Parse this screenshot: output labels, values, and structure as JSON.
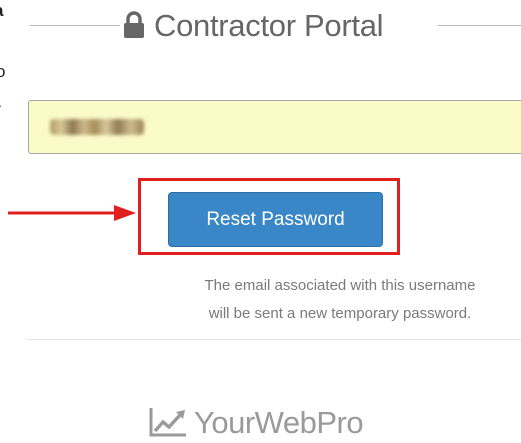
{
  "clipped_text": {
    "top": "a",
    "middle": "o",
    "bottom": "."
  },
  "legend": {
    "title": "Contractor Portal",
    "icon": "lock-icon"
  },
  "username": {
    "value": ""
  },
  "reset": {
    "label": "Reset Password"
  },
  "help": {
    "text": "The email associated with this username will be sent a new temporary password."
  },
  "brand": {
    "name": "YourWebPro",
    "icon": "line-chart-icon"
  },
  "colors": {
    "button": "#3a87c7",
    "highlight": "#e21f1f",
    "input_bg": "#fbfbc8",
    "title_text": "#666666",
    "help_text": "#7a7a7a"
  }
}
